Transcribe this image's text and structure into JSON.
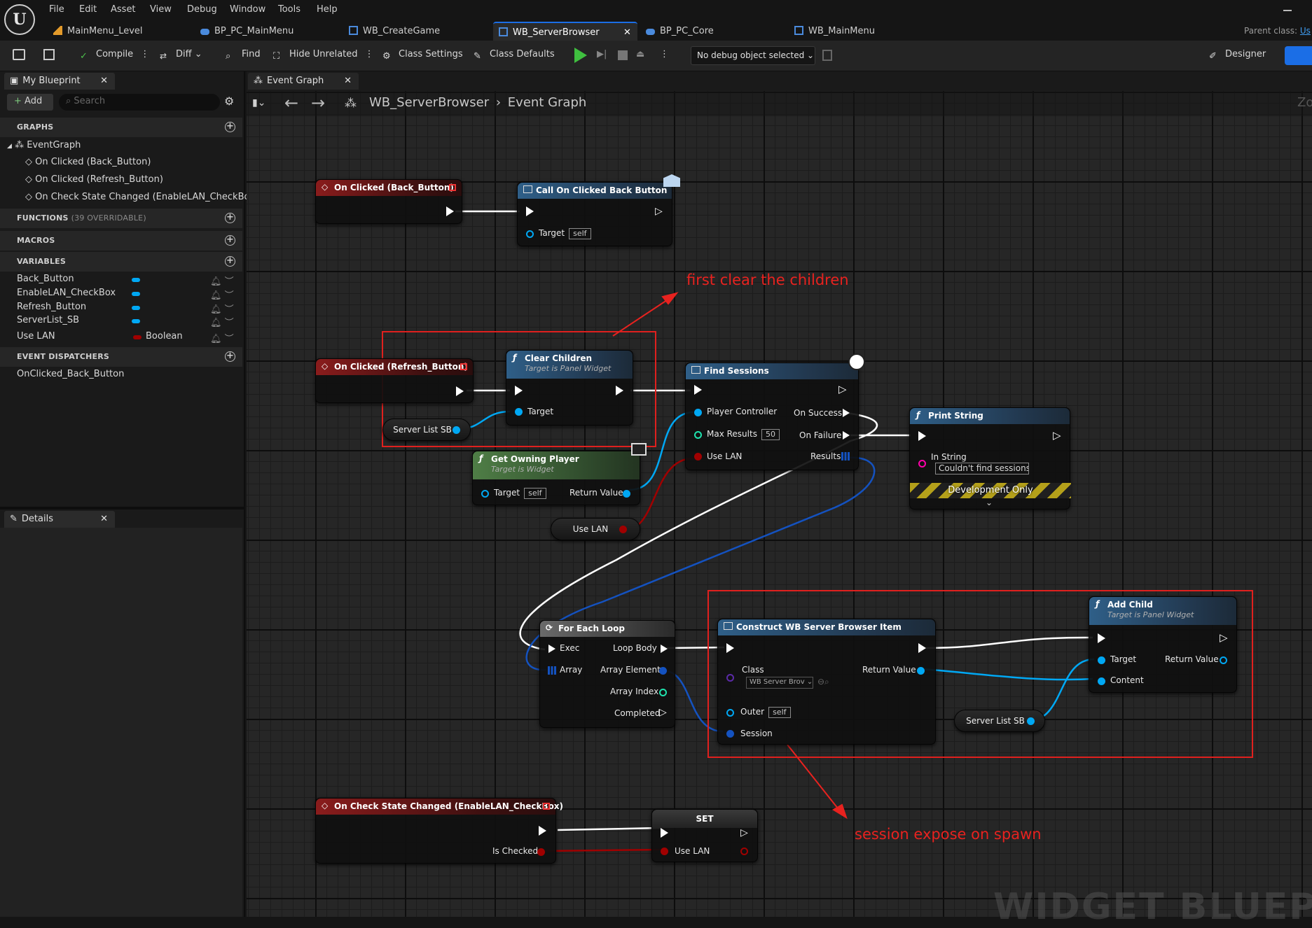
{
  "menu": [
    "File",
    "Edit",
    "Asset",
    "View",
    "Debug",
    "Window",
    "Tools",
    "Help"
  ],
  "tabs": [
    {
      "label": "MainMenu_Level"
    },
    {
      "label": "BP_PC_MainMenu"
    },
    {
      "label": "WB_CreateGame"
    },
    {
      "label": "WB_ServerBrowser",
      "active": true
    },
    {
      "label": "BP_PC_Core"
    },
    {
      "label": "WB_MainMenu"
    }
  ],
  "parent_class": "Parent class:",
  "parent_class_value": "Us",
  "toolbar": {
    "compile": "Compile",
    "diff": "Diff",
    "find": "Find",
    "hide_unrelated": "Hide Unrelated",
    "class_settings": "Class Settings",
    "class_defaults": "Class Defaults",
    "debug_select": "No debug object selected",
    "designer": "Designer"
  },
  "my_blueprint": {
    "tab": "My Blueprint",
    "add": "Add",
    "search_placeholder": "Search",
    "graphs": "GRAPHS",
    "eventgraph": "EventGraph",
    "events": [
      "On Clicked (Back_Button)",
      "On Clicked (Refresh_Button)",
      "On Check State Changed (EnableLAN_CheckBox)"
    ],
    "functions": "FUNCTIONS",
    "functions_sub": "(39 OVERRIDABLE)",
    "macros": "MACROS",
    "variables": "VARIABLES",
    "vars": [
      {
        "name": "Back_Button",
        "type": ""
      },
      {
        "name": "EnableLAN_CheckBox",
        "type": ""
      },
      {
        "name": "Refresh_Button",
        "type": ""
      },
      {
        "name": "ServerList_SB",
        "type": ""
      },
      {
        "name": "Use LAN",
        "type": "Boolean"
      }
    ],
    "dispatchers": "EVENT DISPATCHERS",
    "dispatcher_items": [
      "OnClicked_Back_Button"
    ]
  },
  "details": {
    "tab": "Details"
  },
  "graph": {
    "tab": "Event Graph",
    "breadcrumb_bp": "WB_ServerBrowser",
    "breadcrumb_graph": "Event Graph",
    "watermark": "WIDGET BLUEPRI",
    "zoom": "Zo"
  },
  "nodes": {
    "back_event": "On Clicked (Back_Button)",
    "call_back": "Call On Clicked Back Button",
    "call_back_target": "Target",
    "self": "self",
    "refresh_event": "On Clicked (Refresh_Button)",
    "clear_children": "Clear Children",
    "clear_children_sub": "Target is Panel Widget",
    "target": "Target",
    "server_list_sb": "Server List SB",
    "get_owning": "Get Owning Player",
    "get_owning_sub": "Target is Widget",
    "return_value": "Return Value",
    "use_lan_var": "Use LAN",
    "find_sessions": "Find Sessions",
    "player_controller": "Player Controller",
    "max_results": "Max Results",
    "max_results_val": "50",
    "use_lan": "Use LAN",
    "on_success": "On Success",
    "on_failure": "On Failure",
    "results": "Results",
    "print_string": "Print String",
    "in_string": "In String",
    "in_string_val": "Couldn't find sessions",
    "dev_only": "Development Only",
    "for_each": "For Each Loop",
    "exec": "Exec",
    "array": "Array",
    "loop_body": "Loop Body",
    "array_element": "Array Element",
    "array_index": "Array Index",
    "completed": "Completed",
    "construct": "Construct WB Server Browser Item",
    "class": "Class",
    "class_val": "WB Server Brov",
    "outer": "Outer",
    "session": "Session",
    "add_child": "Add Child",
    "add_child_sub": "Target is Panel Widget",
    "content": "Content",
    "check_event": "On Check State Changed (EnableLAN_CheckBox)",
    "is_checked": "Is Checked",
    "set": "SET"
  },
  "annotations": {
    "clear": "first clear the children",
    "session": "session expose on spawn"
  },
  "colors": {
    "accent": "#1b6ee6",
    "annotation": "#e8221f",
    "object_pin": "#00a8f4",
    "bool_pin": "#a00000",
    "struct_pin": "#0059cc",
    "int_pin": "#1fe3ae"
  }
}
